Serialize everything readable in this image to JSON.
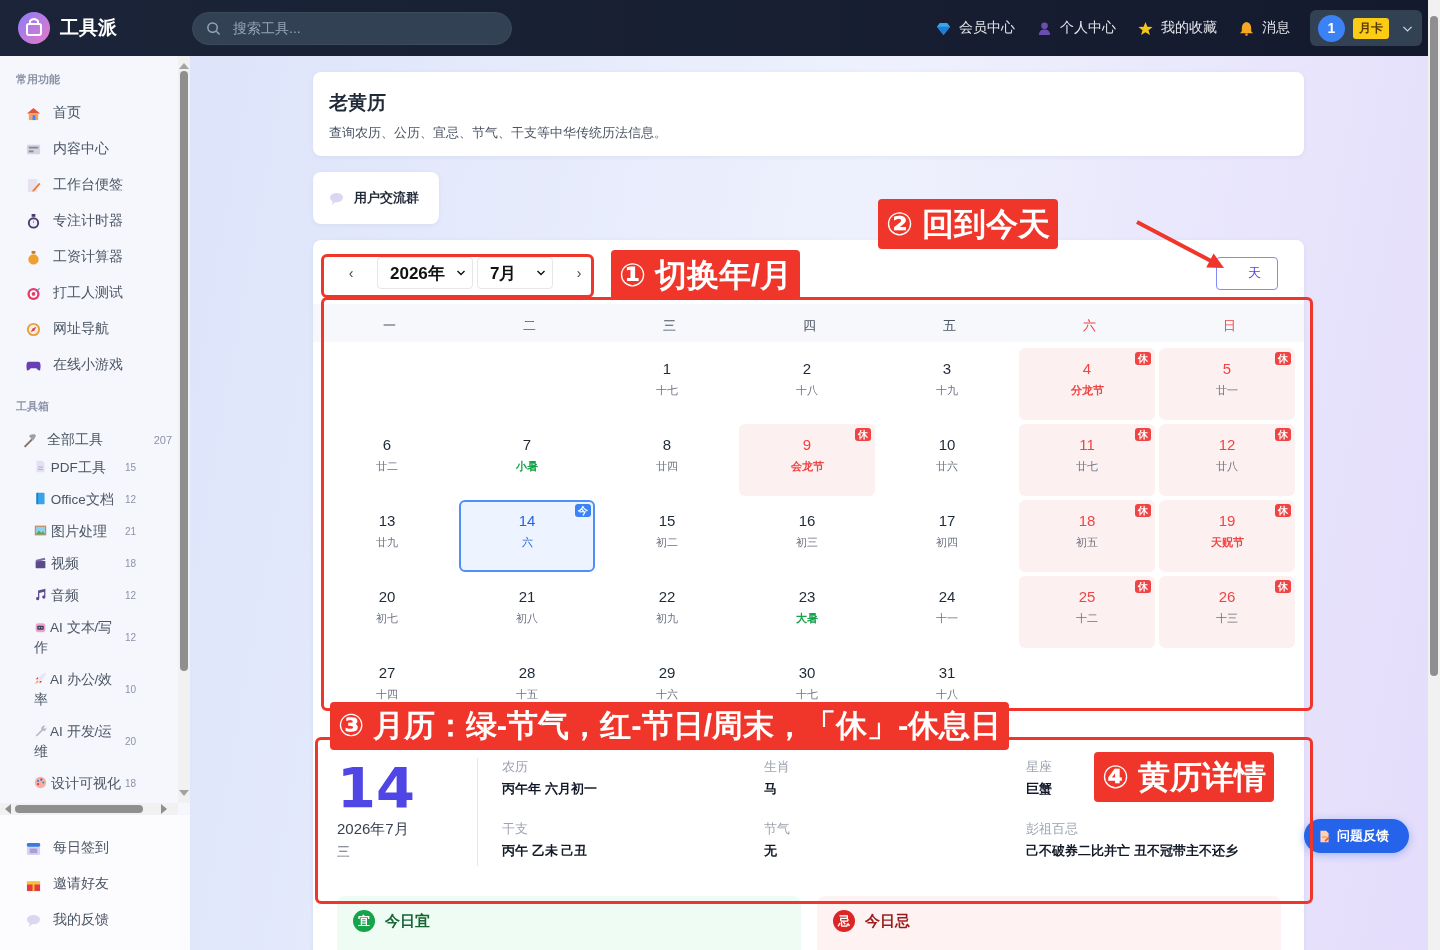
{
  "topbar": {
    "brand": "工具派",
    "search": {
      "placeholder": "搜索工具..."
    },
    "nav": [
      {
        "label": "会员中心"
      },
      {
        "label": "个人中心"
      },
      {
        "label": "我的收藏"
      },
      {
        "label": "消息"
      }
    ],
    "user": {
      "avatar": "1",
      "badge": "月卡"
    }
  },
  "sidebar": {
    "sections": [
      {
        "title": "常用功能",
        "items": [
          {
            "label": "首页"
          },
          {
            "label": "内容中心"
          },
          {
            "label": "工作台便签"
          },
          {
            "label": "专注计时器"
          },
          {
            "label": "工资计算器"
          },
          {
            "label": "打工人测试"
          },
          {
            "label": "网址导航"
          },
          {
            "label": "在线小游戏"
          }
        ]
      },
      {
        "title": "工具箱",
        "items": [
          {
            "label": "全部工具",
            "count": "207",
            "children": [
              {
                "label": "PDF工具",
                "count": "15"
              },
              {
                "label": "Office文档",
                "count": "12"
              },
              {
                "label": "图片处理",
                "count": "21"
              },
              {
                "label": "视频",
                "count": "18"
              },
              {
                "label": "音频",
                "count": "12"
              },
              {
                "label": "AI 文本/写作",
                "count": "12"
              },
              {
                "label": "AI 办公/效率",
                "count": "10"
              },
              {
                "label": "AI 开发/运维",
                "count": "20"
              },
              {
                "label": "设计可视化",
                "count": "18"
              }
            ]
          }
        ]
      }
    ],
    "footer_items": [
      {
        "label": "每日签到"
      },
      {
        "label": "邀请好友"
      },
      {
        "label": "我的反馈"
      }
    ]
  },
  "page": {
    "title": "老黄历",
    "description": "查询农历、公历、宜忌、节气、干支等中华传统历法信息。"
  },
  "group_button": "用户交流群",
  "calendar": {
    "prev": "‹",
    "year": "2026年",
    "month": "7月",
    "next": "›",
    "today_button": "天",
    "weekdays": [
      {
        "label": "一",
        "weekend": false
      },
      {
        "label": "二",
        "weekend": false
      },
      {
        "label": "三",
        "weekend": false
      },
      {
        "label": "四",
        "weekend": false
      },
      {
        "label": "五",
        "weekend": false
      },
      {
        "label": "六",
        "weekend": true
      },
      {
        "label": "日",
        "weekend": true
      }
    ],
    "weeks": [
      [
        {
          "day": "1",
          "lunar": "十七",
          "kind": "plain",
          "rest": false,
          "selected": false
        },
        {
          "day": "2",
          "lunar": "十八",
          "kind": "plain",
          "rest": false,
          "selected": false
        },
        {
          "day": "3",
          "lunar": "十九",
          "kind": "plain",
          "rest": false,
          "selected": false
        },
        {
          "day": "4",
          "lunar": "分龙节",
          "kind": "festival",
          "rest": true,
          "badge": "休",
          "selected": false
        },
        {
          "day": "5",
          "lunar": "廿一",
          "kind": "plain",
          "rest": true,
          "badge": "休",
          "selected": false
        }
      ],
      [
        {
          "day": "6",
          "lunar": "廿二",
          "kind": "plain",
          "rest": false,
          "selected": false
        },
        {
          "day": "7",
          "lunar": "小暑",
          "kind": "term",
          "rest": false,
          "selected": false
        },
        {
          "day": "8",
          "lunar": "廿四",
          "kind": "plain",
          "rest": false,
          "selected": false
        },
        {
          "day": "9",
          "lunar": "会龙节",
          "kind": "festival",
          "rest": true,
          "badge": "休",
          "selected": false
        },
        {
          "day": "10",
          "lunar": "廿六",
          "kind": "plain",
          "rest": false,
          "selected": false
        },
        {
          "day": "11",
          "lunar": "廿七",
          "kind": "plain",
          "rest": true,
          "badge": "休",
          "selected": false
        },
        {
          "day": "12",
          "lunar": "廿八",
          "kind": "plain",
          "rest": true,
          "badge": "休",
          "selected": false
        }
      ],
      [
        {
          "day": "13",
          "lunar": "廿九",
          "kind": "plain",
          "rest": false,
          "selected": false
        },
        {
          "day": "14",
          "lunar": "六",
          "kind": "plain",
          "rest": false,
          "badge": "今",
          "selected": true
        },
        {
          "day": "15",
          "lunar": "初二",
          "kind": "plain",
          "rest": false,
          "selected": false
        },
        {
          "day": "16",
          "lunar": "初三",
          "kind": "plain",
          "rest": false,
          "selected": false
        },
        {
          "day": "17",
          "lunar": "初四",
          "kind": "plain",
          "rest": false,
          "selected": false
        },
        {
          "day": "18",
          "lunar": "初五",
          "kind": "plain",
          "rest": true,
          "badge": "休",
          "selected": false
        },
        {
          "day": "19",
          "lunar": "天贶节",
          "kind": "festival",
          "rest": true,
          "badge": "休",
          "selected": false
        }
      ],
      [
        {
          "day": "20",
          "lunar": "初七",
          "kind": "plain",
          "rest": false,
          "selected": false
        },
        {
          "day": "21",
          "lunar": "初八",
          "kind": "plain",
          "rest": false,
          "selected": false
        },
        {
          "day": "22",
          "lunar": "初九",
          "kind": "plain",
          "rest": false,
          "selected": false
        },
        {
          "day": "23",
          "lunar": "大暑",
          "kind": "term",
          "rest": false,
          "selected": false
        },
        {
          "day": "24",
          "lunar": "十一",
          "kind": "plain",
          "rest": false,
          "selected": false
        },
        {
          "day": "25",
          "lunar": "十二",
          "kind": "plain",
          "rest": true,
          "badge": "休",
          "selected": false
        },
        {
          "day": "26",
          "lunar": "十三",
          "kind": "plain",
          "rest": true,
          "badge": "休",
          "selected": false
        }
      ],
      [
        {
          "day": "27",
          "lunar": "十四",
          "kind": "plain",
          "rest": false,
          "selected": false
        },
        {
          "day": "28",
          "lunar": "十五",
          "kind": "plain",
          "rest": false,
          "selected": false
        },
        {
          "day": "29",
          "lunar": "十六",
          "kind": "plain",
          "rest": false,
          "selected": false
        },
        {
          "day": "30",
          "lunar": "十七",
          "kind": "plain",
          "rest": false,
          "selected": false
        },
        {
          "day": "31",
          "lunar": "十八",
          "kind": "plain",
          "rest": false,
          "selected": false
        }
      ]
    ]
  },
  "details": {
    "day": "14",
    "month": "2026年7月",
    "weekday": "三",
    "fields": [
      {
        "label": "农历",
        "value": "丙午年 六月初一"
      },
      {
        "label": "生肖",
        "value": "马"
      },
      {
        "label": "星座",
        "value": "巨蟹"
      },
      {
        "label": "干支",
        "value": "丙午 乙未 己丑"
      },
      {
        "label": "节气",
        "value": "无"
      },
      {
        "label": "彭祖百忌",
        "value": "己不破券二比并亡 丑不冠带主不还乡"
      }
    ]
  },
  "good": {
    "badge": "宜",
    "title": "今日宜"
  },
  "bad": {
    "badge": "忌",
    "title": "今日忌"
  },
  "feedback_button": "问题反馈",
  "annotations": [
    {
      "label": "① 切换年/月"
    },
    {
      "label": "② 回到今天"
    },
    {
      "label": "③ 月历：绿-节气，红-节日/周末，「休」-休息日"
    },
    {
      "label": "④ 黄历详情"
    }
  ]
}
